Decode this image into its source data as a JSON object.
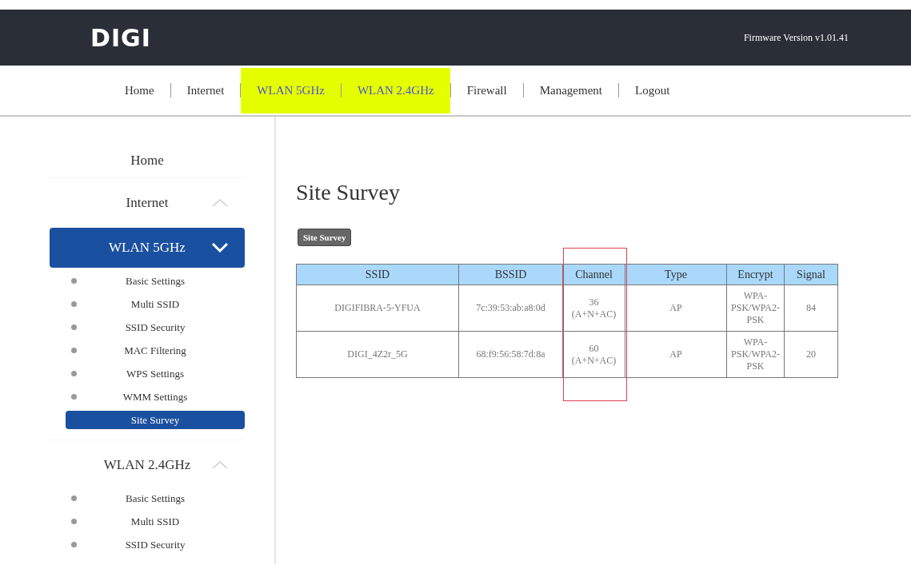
{
  "header": {
    "logo": "DIGI",
    "firmware": "Firmware Version v1.01.41"
  },
  "nav": [
    {
      "label": "Home",
      "highlighted": false
    },
    {
      "label": "Internet",
      "highlighted": false
    },
    {
      "label": "WLAN 5GHz",
      "highlighted": true
    },
    {
      "label": "WLAN 2.4GHz",
      "highlighted": true
    },
    {
      "label": "Firewall",
      "highlighted": false
    },
    {
      "label": "Management",
      "highlighted": false
    },
    {
      "label": "Logout",
      "highlighted": false
    }
  ],
  "sidebar": {
    "items": [
      {
        "kind": "link",
        "label": "Home"
      },
      {
        "kind": "group",
        "label": "Internet",
        "selected": false
      },
      {
        "kind": "group",
        "label": "WLAN 5GHz",
        "selected": true,
        "children": [
          {
            "label": "Basic Settings",
            "selected": false
          },
          {
            "label": "Multi SSID",
            "selected": false
          },
          {
            "label": "SSID Security",
            "selected": false
          },
          {
            "label": "MAC Filtering",
            "selected": false
          },
          {
            "label": "WPS Settings",
            "selected": false
          },
          {
            "label": "WMM Settings",
            "selected": false
          },
          {
            "label": "Site Survey",
            "selected": true
          }
        ]
      },
      {
        "kind": "group",
        "label": "WLAN 2.4GHz",
        "selected": false,
        "children": [
          {
            "label": "Basic Settings",
            "selected": false
          },
          {
            "label": "Multi SSID",
            "selected": false
          },
          {
            "label": "SSID Security",
            "selected": false
          }
        ]
      }
    ]
  },
  "main": {
    "title": "Site Survey",
    "button": "Site Survey",
    "table": {
      "columns": [
        {
          "label": "SSID",
          "outlined": false
        },
        {
          "label": "BSSID",
          "outlined": false
        },
        {
          "label": "Channel",
          "outlined": true
        },
        {
          "label": "Type",
          "outlined": false
        },
        {
          "label": "Encrypt",
          "outlined": false
        },
        {
          "label": "Signal",
          "outlined": false
        }
      ],
      "rows": [
        [
          "DIGIFIBRA-5-YFUA",
          "7c:39:53:ab:a8:0d",
          "36\n(A+N+AC)",
          "AP",
          "WPA-\nPSK/WPA2-\nPSK",
          "84"
        ],
        [
          "DIGI_4Z2r_5G",
          "68:f9:56:58:7d:8a",
          "60\n(A+N+AC)",
          "AP",
          "WPA-\nPSK/WPA2-\nPSK",
          "20"
        ]
      ]
    }
  }
}
